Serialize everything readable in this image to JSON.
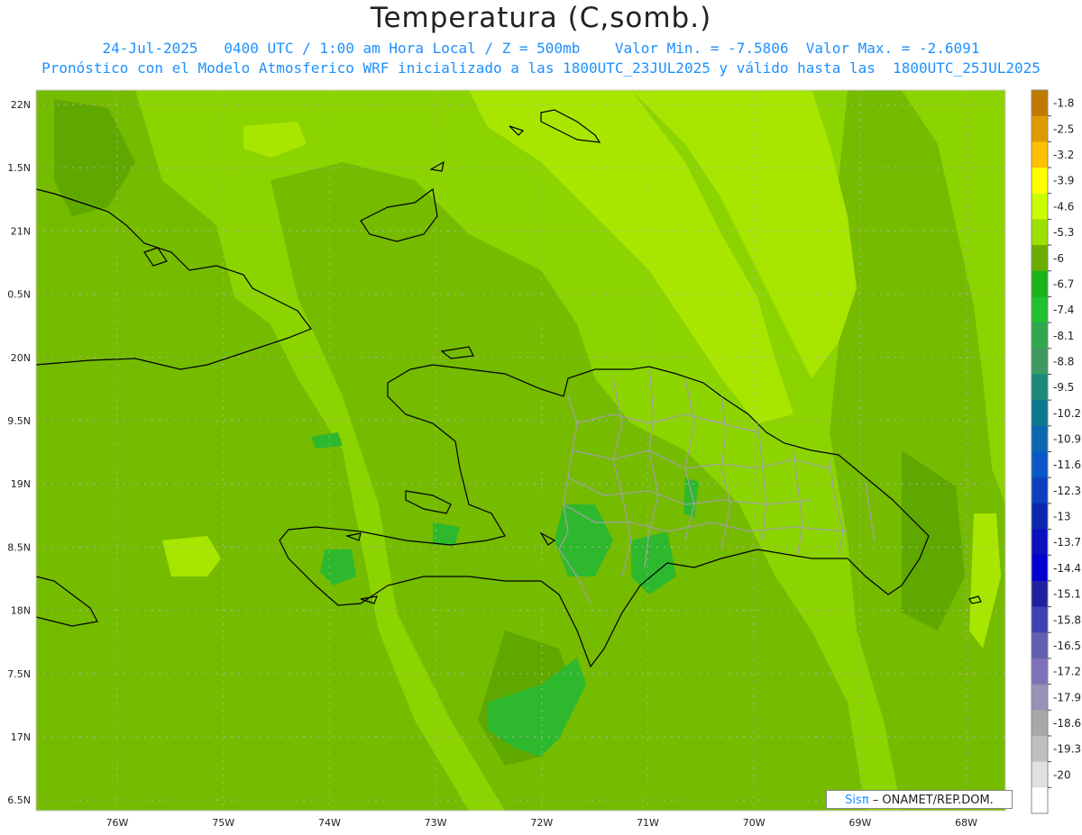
{
  "header": {
    "title": "Temperatura (C,somb.)",
    "line1": "24-Jul-2025   0400 UTC / 1:00 am Hora Local / Z = 500mb    Valor Min. = -7.5806  Valor Max. = -2.6091",
    "line2": "Pronóstico con el Modelo Atmosferico WRF inicializado a las 1800UTC_23JUL2025 y válido hasta las  1800UTC_25JUL2025"
  },
  "axes": {
    "lat_labels": [
      "22N",
      "1.5N",
      "21N",
      "0.5N",
      "20N",
      "9.5N",
      "19N",
      "8.5N",
      "18N",
      "7.5N",
      "17N",
      "6.5N"
    ],
    "lon_labels": [
      "76W",
      "75W",
      "74W",
      "73W",
      "72W",
      "71W",
      "70W",
      "69W",
      "68W"
    ]
  },
  "colorbar": {
    "labels": [
      "-1.8",
      "-2.5",
      "-3.2",
      "-3.9",
      "-4.6",
      "-5.3",
      "-6",
      "-6.7",
      "-7.4",
      "-8.1",
      "-8.8",
      "-9.5",
      "-10.2",
      "-10.9",
      "-11.6",
      "-12.3",
      "-13",
      "-13.7",
      "-14.4",
      "-15.1",
      "-15.8",
      "-16.5",
      "-17.2",
      "-17.9",
      "-18.6",
      "-19.3",
      "-20"
    ],
    "colors": [
      "#c07a00",
      "#e09a00",
      "#ffc000",
      "#ffff00",
      "#c8ff00",
      "#9be000",
      "#6aaf00",
      "#18b418",
      "#20c030",
      "#30a850",
      "#3a9a60",
      "#1a8a7a",
      "#0a7890",
      "#0a68b0",
      "#0a58c8",
      "#0a40c0",
      "#0a28b0",
      "#0a10c0",
      "#0000d0",
      "#2020a0",
      "#4040b0",
      "#6060b0",
      "#8070b8",
      "#9a90b8",
      "#a8a8a8",
      "#c0c0c0",
      "#e0e0e0",
      "#ffffff"
    ]
  },
  "field_colors": {
    "base": "#8cd400",
    "dark": "#75bb00",
    "darker": "#5fa800",
    "light": "#a8e600",
    "green": "#2eb82e"
  },
  "credit": {
    "sis": "Sis",
    "pi": "π",
    "text": "– ONAMET/REP.DOM."
  }
}
